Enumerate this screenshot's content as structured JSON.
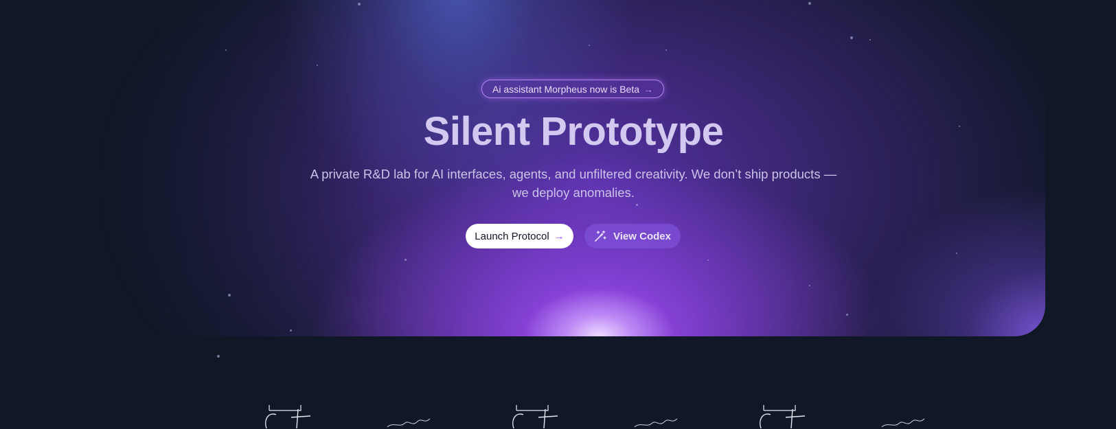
{
  "badge": {
    "label": "Ai assistant Morpheus now is Beta",
    "arrow_icon": "arrow-right-icon"
  },
  "hero": {
    "title": "Silent Prototype",
    "subtitle": "A private R&D lab for AI interfaces, agents, and unfiltered creativity. We don’t ship products — we deploy anomalies."
  },
  "actions": {
    "primary_label": "Launch Protocol",
    "primary_icon": "arrow-right-icon",
    "secondary_label": "View Codex",
    "secondary_icon": "magic-wand-icon"
  },
  "colors": {
    "background": "#101828",
    "accent": "#9b4dff",
    "title": "#d2c8f0"
  },
  "logos": [
    "signature-logo-1",
    "signature-logo-2",
    "signature-logo-3",
    "signature-logo-4",
    "signature-logo-5",
    "signature-logo-6"
  ]
}
